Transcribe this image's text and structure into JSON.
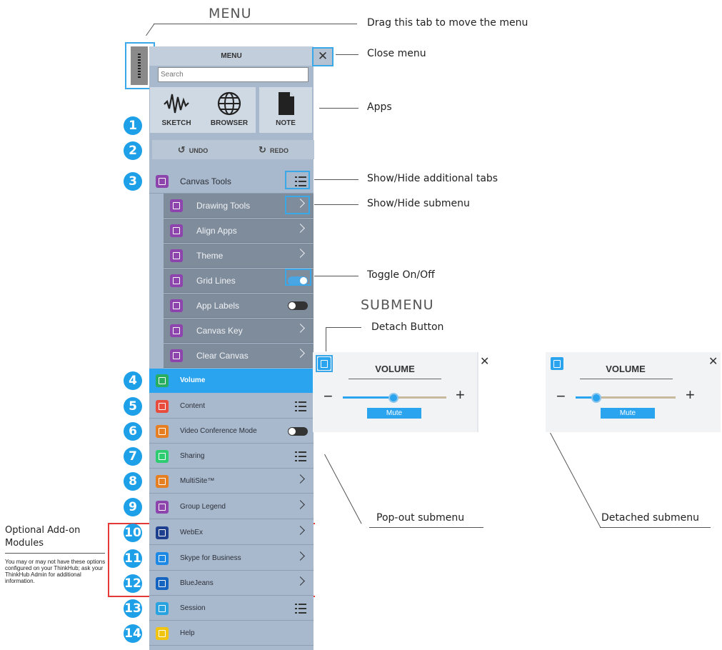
{
  "titles": {
    "menu": "MENU",
    "submenu": "SUBMENU"
  },
  "callouts": {
    "drag": "Drag this tab to move the menu",
    "close": "Close menu",
    "apps": "Apps",
    "show_tabs": "Show/Hide additional tabs",
    "show_submenu": "Show/Hide submenu",
    "toggle": "Toggle On/Off",
    "detach": "Detach Button",
    "popout": "Pop-out submenu",
    "detached": "Detached submenu"
  },
  "addon": {
    "title_line1": "Optional Add-on",
    "title_line2": "Modules",
    "note": "You may or may not have these options configured on your ThinkHub; ask your ThinkHub Admin for additional information."
  },
  "menu": {
    "title": "MENU",
    "close_icon": "close-icon",
    "search_placeholder": "Search",
    "apps": [
      {
        "label": "SKETCH",
        "icon": "sketch-icon"
      },
      {
        "label": "BROWSER",
        "icon": "globe-icon"
      },
      {
        "label": "NOTE",
        "icon": "note-icon"
      }
    ],
    "undo": "UNDO",
    "redo": "REDO",
    "items": [
      {
        "num": "3",
        "label": "Canvas Tools",
        "color": "#8e44ad",
        "control": "list"
      },
      {
        "label": "Drawing Tools",
        "color": "#8e44ad",
        "control": "chevron"
      },
      {
        "label": "Align Apps",
        "color": "#8e44ad",
        "control": "chevron"
      },
      {
        "label": "Theme",
        "color": "#8e44ad",
        "control": "chevron"
      },
      {
        "label": "Grid Lines",
        "color": "#8e44ad",
        "control": "toggle",
        "on": true
      },
      {
        "label": "App Labels",
        "color": "#8e44ad",
        "control": "toggle",
        "on": false
      },
      {
        "label": "Canvas Key",
        "color": "#8e44ad",
        "control": "chevron"
      },
      {
        "label": "Clear Canvas",
        "color": "#8e44ad",
        "control": "chevron"
      },
      {
        "num": "4",
        "label": "Volume",
        "color": "#27ae60",
        "control": "none"
      },
      {
        "num": "5",
        "label": "Content",
        "color": "#e74c3c",
        "control": "list"
      },
      {
        "num": "6",
        "label": "Video Conference Mode",
        "color": "#e67e22",
        "control": "toggle",
        "on": false
      },
      {
        "num": "7",
        "label": "Sharing",
        "color": "#2ecc71",
        "control": "list"
      },
      {
        "num": "8",
        "label": "MultiSite™",
        "color": "#e67e22",
        "control": "chevron"
      },
      {
        "num": "9",
        "label": "Group Legend",
        "color": "#8e44ad",
        "control": "chevron"
      },
      {
        "num": "10",
        "label": "WebEx",
        "color": "#1f3f8f",
        "control": "chevron"
      },
      {
        "num": "11",
        "label": "Skype for Business",
        "color": "#1e88e5",
        "control": "chevron"
      },
      {
        "num": "12",
        "label": "BlueJeans",
        "color": "#1565c0",
        "control": "chevron"
      },
      {
        "num": "13",
        "label": "Session",
        "color": "#29a3e0",
        "control": "list"
      },
      {
        "num": "14",
        "label": "Help",
        "color": "#f1c40f",
        "control": "none"
      }
    ]
  },
  "numbers_top": [
    "1",
    "2"
  ],
  "popout": {
    "title": "VOLUME",
    "minus": "−",
    "plus": "+",
    "mute": "Mute",
    "level": 0.48,
    "close_icon": "close-icon"
  },
  "detached": {
    "title": "VOLUME",
    "minus": "−",
    "plus": "+",
    "mute": "Mute",
    "level": 0.2,
    "close_icon": "close-icon"
  }
}
